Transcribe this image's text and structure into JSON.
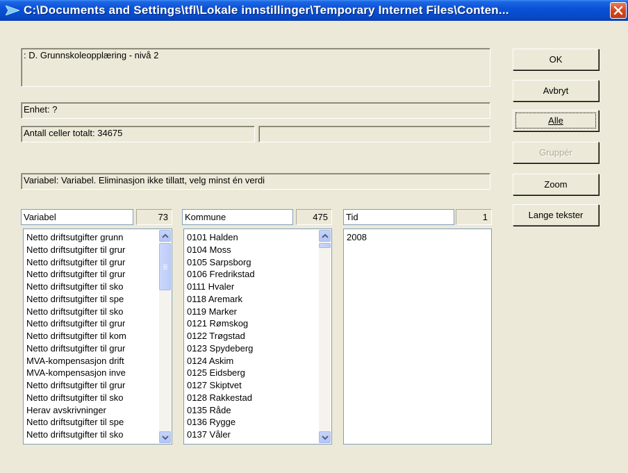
{
  "window": {
    "title": "C:\\Documents and Settings\\tfl\\Lokale innstillinger\\Temporary Internet Files\\Conten..."
  },
  "info": {
    "table_name": ": D. Grunnskoleopplæring - nivå 2",
    "unit": "Enhet: ?",
    "cell_count": "Antall celler totalt:  34675",
    "cell_extra": "",
    "variable_desc": "Variabel: Variabel. Eliminasjon ikke tillatt, velg minst én verdi"
  },
  "buttons": {
    "ok": "OK",
    "cancel": "Avbryt",
    "all": "Alle",
    "group": "Gruppér",
    "zoom": "Zoom",
    "long_texts": "Lange tekster"
  },
  "lists": {
    "variabel": {
      "header": "Variabel",
      "count": "73",
      "items": [
        "Netto driftsutgifter grunn",
        "Netto driftsutgifter til grur",
        "Netto driftsutgifter til grur",
        "Netto driftsutgifter til grur",
        "Netto driftsutgifter til sko",
        "Netto driftsutgifter til spe",
        "Netto driftsutgifter til sko",
        "Netto driftsutgifter til grur",
        "Netto driftsutgifter til kom",
        "Netto driftsutgifter til grur",
        "MVA-kompensasjon drift",
        "MVA-kompensasjon inve",
        "Netto driftsutgifter til grur",
        "Netto driftsutgifter til sko",
        "Herav avskrivninger",
        "Netto driftsutgifter til spe",
        "Netto driftsutgifter til sko"
      ]
    },
    "kommune": {
      "header": "Kommune",
      "count": "475",
      "items": [
        "0101 Halden",
        "0104 Moss",
        "0105 Sarpsborg",
        "0106 Fredrikstad",
        "0111 Hvaler",
        "0118 Aremark",
        "0119 Marker",
        "0121 Rømskog",
        "0122 Trøgstad",
        "0123 Spydeberg",
        "0124 Askim",
        "0125 Eidsberg",
        "0127 Skiptvet",
        "0128 Rakkestad",
        "0135 Råde",
        "0136 Rygge",
        "0137 Våler"
      ]
    },
    "tid": {
      "header": "Tid",
      "count": "1",
      "items": [
        "2008"
      ]
    }
  }
}
